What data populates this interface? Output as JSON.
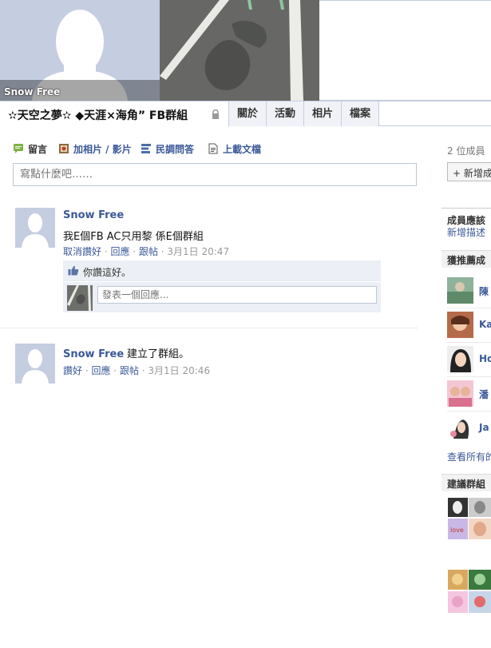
{
  "profile": {
    "name": "Snow Free"
  },
  "group": {
    "title": "✫天空之夢✫ ◆天涯×海角” FB群組"
  },
  "tabs": [
    {
      "label": "關於"
    },
    {
      "label": "活動"
    },
    {
      "label": "相片"
    },
    {
      "label": "檔案"
    }
  ],
  "composer": {
    "actions": [
      {
        "label": "留言",
        "icon": "comment-icon"
      },
      {
        "label": "加相片 / 影片",
        "icon": "photo-icon"
      },
      {
        "label": "民調問答",
        "icon": "poll-icon"
      },
      {
        "label": "上載文檔",
        "icon": "document-icon"
      }
    ],
    "placeholder": "寫點什麼吧……"
  },
  "posts": [
    {
      "author": "Snow Free",
      "text": "我E個FB AC只用黎 係E個群組",
      "actions": [
        "取消讚好",
        "回應",
        "跟帖"
      ],
      "time": "3月1日 20:47",
      "like_text": "你讚這好。",
      "comment_placeholder": "發表一個回應..."
    },
    {
      "author": "Snow Free",
      "action_text": "建立了群組。",
      "actions": [
        "讚好",
        "回應",
        "跟帖"
      ],
      "time": "3月1日 20:46"
    }
  ],
  "sidebar": {
    "member_count": "2 位成員",
    "add_button": "+ 新增成",
    "section_should_know": "成員應該",
    "add_description": "新增描述",
    "section_recommended": "獲推薦成",
    "members": [
      {
        "name": "陳"
      },
      {
        "name": "Ka"
      },
      {
        "name": "Ho"
      },
      {
        "name": "潘"
      },
      {
        "name": "Ja"
      }
    ],
    "see_all": "查看所有的",
    "section_suggested_groups": "建議群組"
  },
  "colors": {
    "link": "#3b5998",
    "tab_bg": "#f0f2f7",
    "panel_bg": "#eceff5"
  }
}
